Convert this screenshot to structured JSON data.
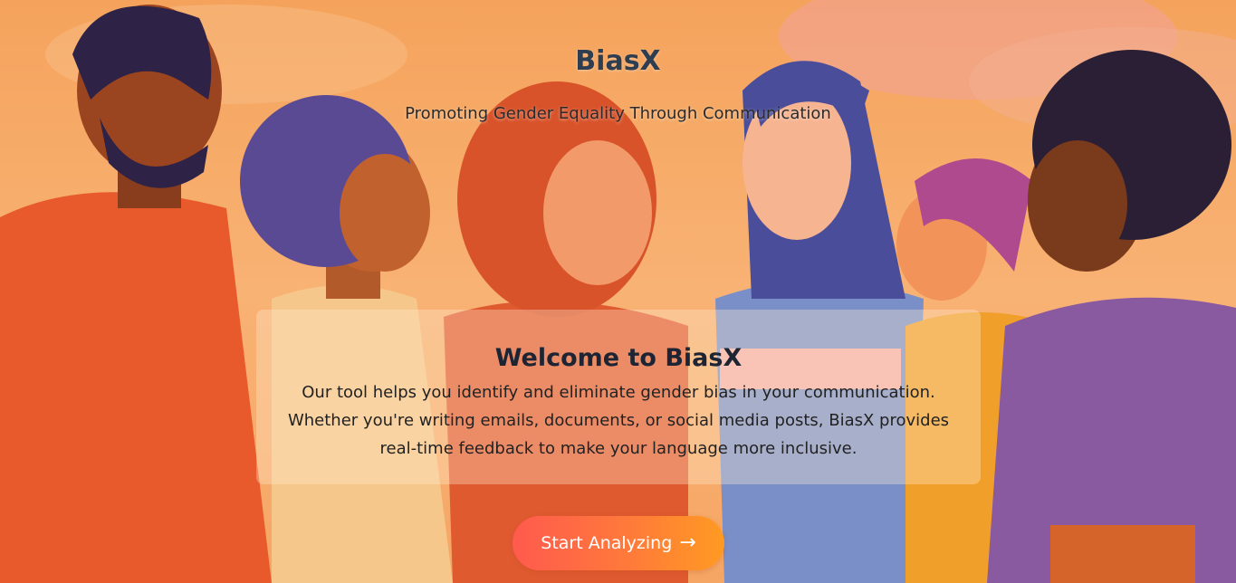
{
  "hero": {
    "title": "BiasX",
    "subtitle": "Promoting Gender Equality Through Communication"
  },
  "welcome": {
    "title": "Welcome to BiasX",
    "text": "Our tool helps you identify and eliminate gender bias in your communication. Whether you're writing emails, documents, or social media posts, BiasX provides real-time feedback to make your language more inclusive."
  },
  "cta": {
    "label": "Start Analyzing",
    "arrow": "→"
  },
  "colors": {
    "background": "#f3a765",
    "title": "#2e3d4f",
    "cta_start": "#ff5a4e",
    "cta_end": "#ff9a22"
  }
}
